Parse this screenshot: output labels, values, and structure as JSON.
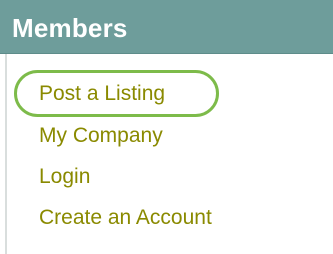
{
  "section": {
    "title": "Members"
  },
  "menu": {
    "items": [
      {
        "label": "Post a Listing",
        "highlighted": true
      },
      {
        "label": "My Company",
        "highlighted": false
      },
      {
        "label": "Login",
        "highlighted": false
      },
      {
        "label": "Create an Account",
        "highlighted": false
      }
    ]
  },
  "colors": {
    "header_background": "#6e9d9b",
    "header_text": "#ffffff",
    "link_text": "#8a8a00",
    "highlight_ring": "#7dbb4a"
  }
}
